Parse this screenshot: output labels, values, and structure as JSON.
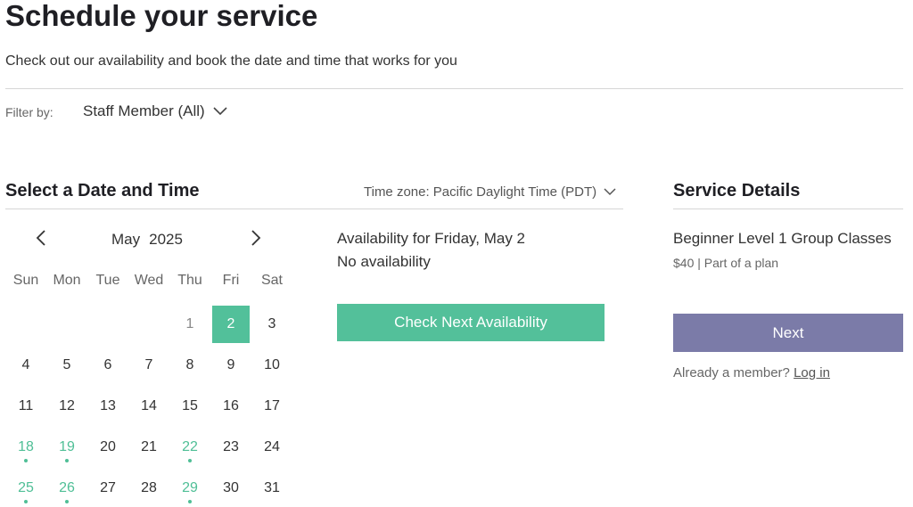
{
  "header": {
    "title": "Schedule your service",
    "subtitle": "Check out our availability and book the date and time that works for you"
  },
  "filter": {
    "label": "Filter by:",
    "staff_select": "Staff Member (All)"
  },
  "scheduler": {
    "section_title": "Select a Date and Time",
    "timezone": "Time zone: Pacific Daylight Time (PDT)",
    "month": "May",
    "year": "2025",
    "weekdays": [
      "Sun",
      "Mon",
      "Tue",
      "Wed",
      "Thu",
      "Fri",
      "Sat"
    ],
    "weeks": [
      [
        {
          "d": "",
          "s": "empty"
        },
        {
          "d": "",
          "s": "empty"
        },
        {
          "d": "",
          "s": "empty"
        },
        {
          "d": "",
          "s": "empty"
        },
        {
          "d": "1",
          "s": "muted"
        },
        {
          "d": "2",
          "s": "selected"
        },
        {
          "d": "3",
          "s": "normal"
        }
      ],
      [
        {
          "d": "4",
          "s": "normal"
        },
        {
          "d": "5",
          "s": "normal"
        },
        {
          "d": "6",
          "s": "normal"
        },
        {
          "d": "7",
          "s": "normal"
        },
        {
          "d": "8",
          "s": "normal"
        },
        {
          "d": "9",
          "s": "normal"
        },
        {
          "d": "10",
          "s": "normal"
        }
      ],
      [
        {
          "d": "11",
          "s": "normal"
        },
        {
          "d": "12",
          "s": "normal"
        },
        {
          "d": "13",
          "s": "normal"
        },
        {
          "d": "14",
          "s": "normal"
        },
        {
          "d": "15",
          "s": "normal"
        },
        {
          "d": "16",
          "s": "normal"
        },
        {
          "d": "17",
          "s": "normal"
        }
      ],
      [
        {
          "d": "18",
          "s": "avail"
        },
        {
          "d": "19",
          "s": "avail"
        },
        {
          "d": "20",
          "s": "normal"
        },
        {
          "d": "21",
          "s": "normal"
        },
        {
          "d": "22",
          "s": "avail"
        },
        {
          "d": "23",
          "s": "normal"
        },
        {
          "d": "24",
          "s": "normal"
        }
      ],
      [
        {
          "d": "25",
          "s": "avail"
        },
        {
          "d": "26",
          "s": "avail"
        },
        {
          "d": "27",
          "s": "normal"
        },
        {
          "d": "28",
          "s": "normal"
        },
        {
          "d": "29",
          "s": "avail"
        },
        {
          "d": "30",
          "s": "normal"
        },
        {
          "d": "31",
          "s": "normal"
        }
      ]
    ],
    "availability_title": "Availability for Friday, May 2",
    "availability_status": "No availability",
    "check_next_label": "Check Next Availability"
  },
  "service": {
    "section_title": "Service Details",
    "name": "Beginner Level 1 Group Classes",
    "meta": "$40 | Part of a plan",
    "next_label": "Next",
    "member_prompt": "Already a member?",
    "login_label": "Log in"
  },
  "colors": {
    "accent_green": "#53c09a",
    "button_purple": "#7b7ba8"
  }
}
